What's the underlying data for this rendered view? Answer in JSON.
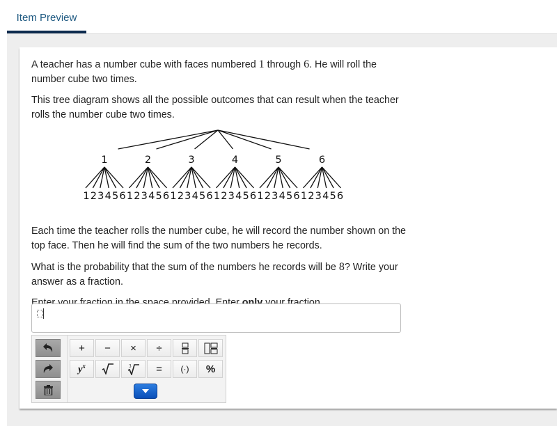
{
  "tabs": [
    {
      "label": "Item Preview",
      "active": true
    }
  ],
  "question": {
    "p1": {
      "before": "A teacher has a number cube with faces numbered ",
      "n1": "1",
      "mid": " through ",
      "n2": "6",
      "after": ". He will roll the number cube two times."
    },
    "p2": "This tree diagram shows all the possible outcomes that can result when the teacher rolls the number cube two times.",
    "p3": "Each time the teacher rolls the number cube, he will record the number shown on the top face. Then he will find the sum of the two numbers he records.",
    "p4": {
      "before": "What is the probability that the sum of the numbers he records will be ",
      "n": "8",
      "after": "? Write your answer as a fraction."
    },
    "p5": {
      "before": "Enter your fraction in the space provided. Enter ",
      "bold": "only",
      "after": " your fraction."
    }
  },
  "tree_diagram": {
    "first_roll": [
      "1",
      "2",
      "3",
      "4",
      "5",
      "6"
    ],
    "second_roll": [
      "1",
      "2",
      "3",
      "4",
      "5",
      "6"
    ]
  },
  "answer": {
    "value": ""
  },
  "toolbar": {
    "side": [
      {
        "name": "undo-button",
        "icon": "undo-icon"
      },
      {
        "name": "redo-button",
        "icon": "redo-icon"
      },
      {
        "name": "clear-button",
        "icon": "trash-icon"
      }
    ],
    "row1": [
      {
        "name": "plus-key",
        "label": "+"
      },
      {
        "name": "minus-key",
        "label": "−"
      },
      {
        "name": "times-key",
        "label": "×"
      },
      {
        "name": "divide-key",
        "label": "÷"
      },
      {
        "name": "fraction-key",
        "label": "fraction"
      },
      {
        "name": "mixed-number-key",
        "label": "mixed-number"
      }
    ],
    "row2": [
      {
        "name": "exponent-key",
        "label": "yˣ"
      },
      {
        "name": "square-root-key",
        "label": "√‾"
      },
      {
        "name": "cube-root-key",
        "label": "∛‾"
      },
      {
        "name": "equals-key",
        "label": "="
      },
      {
        "name": "parentheses-key",
        "label": "(·)"
      },
      {
        "name": "percent-key",
        "label": "%"
      }
    ],
    "more_button": "chevron-down-icon"
  }
}
